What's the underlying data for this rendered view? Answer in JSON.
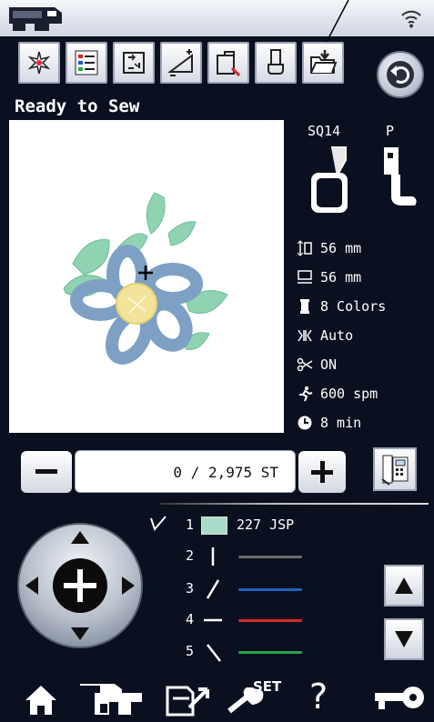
{
  "status": {
    "title": "Ready to Sew"
  },
  "hoop": {
    "label": "SQ14",
    "foot_label": "P"
  },
  "info": {
    "height": "56 mm",
    "width": "56 mm",
    "colors": "8 Colors",
    "tension": "Auto",
    "cutter": "ON",
    "speed": "600 spm",
    "time": "8 min"
  },
  "stitch": {
    "value": "0 / 2,975 ST"
  },
  "colors": [
    {
      "number": "1",
      "swatch": "#a8dcc8",
      "name": "227 JSP",
      "line_color": ""
    },
    {
      "number": "2",
      "line_color": "#6b6b6b"
    },
    {
      "number": "3",
      "line_color": "#1f63c8"
    },
    {
      "number": "4",
      "line_color": "#d42a2a"
    },
    {
      "number": "5",
      "line_color": "#22a34a"
    }
  ],
  "icons": {
    "toolbar": [
      "embroidery-design-icon",
      "color-list-icon",
      "hoop-edit-icon",
      "tension-adjust-icon",
      "hoop-trace-icon",
      "presser-foot-icon",
      "open-folder-icon"
    ],
    "bottom": [
      "home-icon",
      "sewing-machine-icon",
      "save-file-icon",
      "settings-wrench-icon",
      "help-icon",
      "key-lock-icon"
    ],
    "set_label": "SET",
    "help_label": "?"
  },
  "accent": {
    "toolbar_bg": "#e3e7ef",
    "screen_bg": "#0b1020"
  }
}
